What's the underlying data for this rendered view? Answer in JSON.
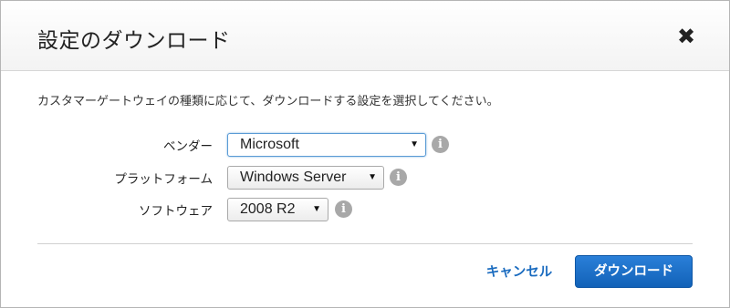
{
  "dialog": {
    "title": "設定のダウンロード",
    "close_label": "✖",
    "description": "カスタマーゲートウェイの種類に応じて、ダウンロードする設定を選択してください。"
  },
  "form": {
    "vendor": {
      "label": "ベンダー",
      "value": "Microsoft"
    },
    "platform": {
      "label": "プラットフォーム",
      "value": "Windows Server"
    },
    "software": {
      "label": "ソフトウェア",
      "value": "2008 R2"
    }
  },
  "icons": {
    "info": "info-icon",
    "close": "close-icon",
    "dropdown": "chevron-down-icon"
  },
  "footer": {
    "cancel_label": "キャンセル",
    "download_label": "ダウンロード"
  },
  "colors": {
    "primary": "#1a6bbf",
    "info_icon": "#a8a8a8"
  }
}
